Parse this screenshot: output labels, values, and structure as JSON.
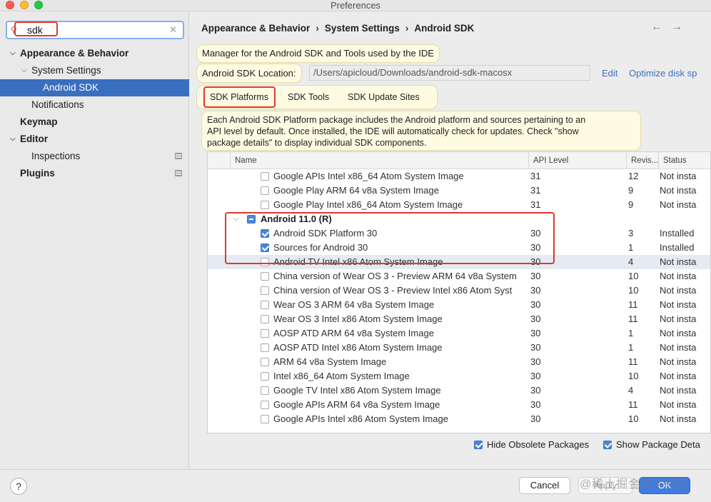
{
  "window": {
    "title": "Preferences"
  },
  "sidebar": {
    "search_value": "sdk",
    "items": [
      {
        "label": "Appearance & Behavior",
        "level": 0,
        "bold": true,
        "expanded": true
      },
      {
        "label": "System Settings",
        "level": 1,
        "bold": false,
        "expanded": true
      },
      {
        "label": "Android SDK",
        "level": 2,
        "bold": false,
        "selected": true
      },
      {
        "label": "Notifications",
        "level": 1,
        "bold": false
      },
      {
        "label": "Keymap",
        "level": 0,
        "bold": true
      },
      {
        "label": "Editor",
        "level": 0,
        "bold": true,
        "expanded": true
      },
      {
        "label": "Inspections",
        "level": 1,
        "bold": false
      },
      {
        "label": "Plugins",
        "level": 0,
        "bold": true
      }
    ]
  },
  "breadcrumb": [
    "Appearance & Behavior",
    "System Settings",
    "Android SDK"
  ],
  "main": {
    "description": "Manager for the Android SDK and Tools used by the IDE",
    "location_label": "Android SDK Location:",
    "location_value": "/Users/apicloud/Downloads/android-sdk-macosx",
    "edit_link": "Edit",
    "optimize_link": "Optimize disk sp",
    "tabs": [
      "SDK Platforms",
      "SDK Tools",
      "SDK Update Sites"
    ],
    "platform_info_lines": [
      "Each Android SDK Platform package includes the Android platform and sources pertaining to an",
      "API level by default. Once installed, the IDE will automatically check for updates. Check \"show",
      "package details\" to display individual SDK components."
    ]
  },
  "table": {
    "columns": [
      "Name",
      "API Level",
      "Revis...",
      "Status"
    ],
    "rows": [
      {
        "name": "Google APIs Intel x86_64 Atom System Image",
        "api": "31",
        "rev": "12",
        "status": "Not insta",
        "checked": false
      },
      {
        "name": "Google Play ARM 64 v8a System Image",
        "api": "31",
        "rev": "9",
        "status": "Not insta",
        "checked": false
      },
      {
        "name": "Google Play Intel x86_64 Atom System Image",
        "api": "31",
        "rev": "9",
        "status": "Not insta",
        "checked": false
      },
      {
        "name": "Android 11.0 (R)",
        "api": "",
        "rev": "",
        "status": "",
        "group": true,
        "mixed": true
      },
      {
        "name": "Android SDK Platform 30",
        "api": "30",
        "rev": "3",
        "status": "Installed",
        "checked": true
      },
      {
        "name": "Sources for Android 30",
        "api": "30",
        "rev": "1",
        "status": "Installed",
        "checked": true
      },
      {
        "name": "Android TV Intel x86 Atom System Image",
        "api": "30",
        "rev": "4",
        "status": "Not insta",
        "checked": false,
        "selected": true
      },
      {
        "name": "China version of Wear OS 3 - Preview ARM 64 v8a System",
        "api": "30",
        "rev": "10",
        "status": "Not insta",
        "checked": false
      },
      {
        "name": "China version of Wear OS 3 - Preview Intel x86 Atom Syst",
        "api": "30",
        "rev": "10",
        "status": "Not insta",
        "checked": false
      },
      {
        "name": "Wear OS 3 ARM 64 v8a System Image",
        "api": "30",
        "rev": "11",
        "status": "Not insta",
        "checked": false
      },
      {
        "name": "Wear OS 3 Intel x86 Atom System Image",
        "api": "30",
        "rev": "11",
        "status": "Not insta",
        "checked": false
      },
      {
        "name": "AOSP ATD ARM 64 v8a System Image",
        "api": "30",
        "rev": "1",
        "status": "Not insta",
        "checked": false
      },
      {
        "name": "AOSP ATD Intel x86 Atom System Image",
        "api": "30",
        "rev": "1",
        "status": "Not insta",
        "checked": false
      },
      {
        "name": "ARM 64 v8a System Image",
        "api": "30",
        "rev": "11",
        "status": "Not insta",
        "checked": false
      },
      {
        "name": "Intel x86_64 Atom System Image",
        "api": "30",
        "rev": "10",
        "status": "Not insta",
        "checked": false
      },
      {
        "name": "Google TV Intel x86 Atom System Image",
        "api": "30",
        "rev": "4",
        "status": "Not insta",
        "checked": false
      },
      {
        "name": "Google APIs ARM 64 v8a System Image",
        "api": "30",
        "rev": "11",
        "status": "Not insta",
        "checked": false
      },
      {
        "name": "Google APIs Intel x86 Atom System Image",
        "api": "30",
        "rev": "10",
        "status": "Not insta",
        "checked": false
      }
    ]
  },
  "options": {
    "hide_obsolete": {
      "label": "Hide Obsolete Packages",
      "checked": true
    },
    "show_details": {
      "label": "Show Package Deta",
      "checked": true
    }
  },
  "footer": {
    "help": "?",
    "cancel": "Cancel",
    "apply": "Apply",
    "ok": "OK",
    "watermark": "@稀土掘金技术社区"
  },
  "colors": {
    "accent": "#3e7ce1",
    "selection": "#3a6ebf",
    "highlight": "#e0382b"
  }
}
